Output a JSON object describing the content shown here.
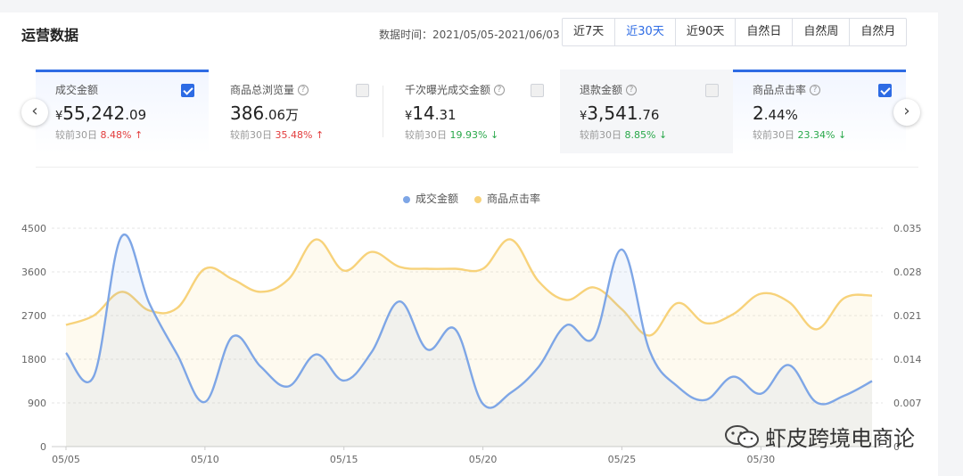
{
  "header": {
    "title": "运营数据",
    "date_range": "数据时间：2021/05/05-2021/06/03",
    "tabs": [
      {
        "label": "近7天",
        "active": false
      },
      {
        "label": "近30天",
        "active": true
      },
      {
        "label": "近90天",
        "active": false
      },
      {
        "label": "自然日",
        "active": false
      },
      {
        "label": "自然周",
        "active": false
      },
      {
        "label": "自然月",
        "active": false
      }
    ]
  },
  "cards": [
    {
      "label": "成交金额",
      "currency": "¥",
      "int": "55,242",
      "dec": ".09",
      "unit": "",
      "compare_label": "较前30日",
      "compare_value": "8.48%",
      "trend": "up",
      "checked": true,
      "help": false
    },
    {
      "label": "商品总浏览量",
      "currency": "",
      "int": "386",
      "dec": ".06万",
      "unit": "",
      "compare_label": "较前30日",
      "compare_value": "35.48%",
      "trend": "up",
      "checked": false,
      "help": true
    },
    {
      "label": "千次曝光成交金额",
      "currency": "¥",
      "int": "14",
      "dec": ".31",
      "unit": "",
      "compare_label": "较前30日",
      "compare_value": "19.93%",
      "trend": "down",
      "checked": false,
      "help": true
    },
    {
      "label": "退款金额",
      "currency": "¥",
      "int": "3,541",
      "dec": ".76",
      "unit": "",
      "compare_label": "较前30日",
      "compare_value": "8.85%",
      "trend": "down",
      "checked": false,
      "help": true
    },
    {
      "label": "商品点击率",
      "currency": "",
      "int": "2",
      "dec": ".44%",
      "unit": "",
      "compare_label": "较前30日",
      "compare_value": "23.34%",
      "trend": "down",
      "checked": true,
      "help": true
    }
  ],
  "nav": {
    "prev": "‹",
    "next": "›"
  },
  "colors": {
    "blue": "#7ea6e6",
    "yellow": "#f7d27a",
    "accent": "#2d6be4"
  },
  "watermark": "虾皮跨境电商论",
  "chart_data": {
    "type": "line",
    "x": [
      "05/05",
      "05/06",
      "05/07",
      "05/08",
      "05/09",
      "05/10",
      "05/11",
      "05/12",
      "05/13",
      "05/14",
      "05/15",
      "05/16",
      "05/17",
      "05/18",
      "05/19",
      "05/20",
      "05/21",
      "05/22",
      "05/23",
      "05/24",
      "05/25",
      "05/26",
      "05/27",
      "05/28",
      "05/29",
      "05/30",
      "05/31",
      "06/01",
      "06/02",
      "06/03"
    ],
    "x_tick_labels": [
      "05/05",
      "05/10",
      "05/15",
      "05/20",
      "05/25",
      "05/30"
    ],
    "y_left_ticks": [
      "0",
      "900",
      "1800",
      "2700",
      "3600",
      "4500"
    ],
    "y_right_ticks": [
      "0",
      "0.007",
      "0.014",
      "0.021",
      "0.028",
      "0.035"
    ],
    "ylim_left": [
      0,
      4500
    ],
    "ylim_right": [
      0,
      0.035
    ],
    "series": [
      {
        "name": "成交金额",
        "axis": "left",
        "color": "#7ea6e6",
        "values": [
          1930,
          1450,
          4330,
          2950,
          1900,
          920,
          2270,
          1650,
          1240,
          1900,
          1360,
          1950,
          2990,
          2000,
          2420,
          880,
          1110,
          1640,
          2500,
          2250,
          4060,
          1970,
          1240,
          960,
          1440,
          1090,
          1680,
          910,
          1050,
          1350
        ]
      },
      {
        "name": "商品点击率",
        "axis": "right",
        "color": "#f7d27a",
        "values": [
          0.0195,
          0.021,
          0.0248,
          0.0218,
          0.0222,
          0.0285,
          0.0268,
          0.0248,
          0.0268,
          0.0332,
          0.0282,
          0.0312,
          0.0288,
          0.0285,
          0.0285,
          0.0285,
          0.0332,
          0.0265,
          0.0235,
          0.0255,
          0.022,
          0.0178,
          0.023,
          0.0198,
          0.0212,
          0.0245,
          0.0232,
          0.0188,
          0.0238,
          0.0242
        ]
      }
    ],
    "legend_position": "top-center",
    "grid": true
  }
}
